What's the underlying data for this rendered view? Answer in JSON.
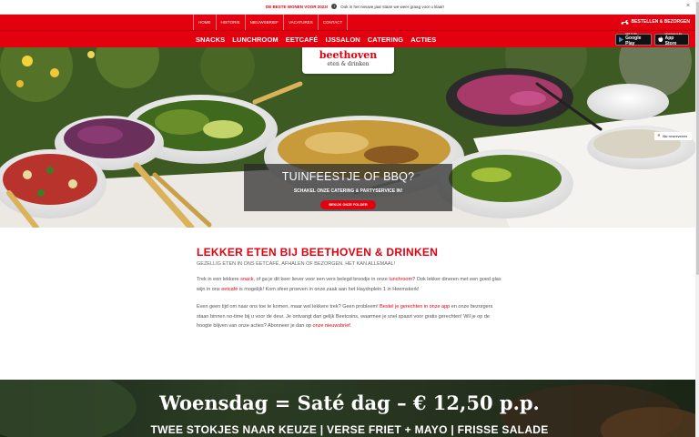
{
  "notice": {
    "headline": "DE BESTE WONEN VOOR 2023!",
    "message": "Ook in het nieuwe jaar staan we weer graag voor u klaar!",
    "close_label": "×"
  },
  "utilbar": {
    "links": [
      "Home",
      "Historie",
      "Nieuwsbrief",
      "Vacatures",
      "Contact"
    ],
    "order_label": "Bestellen & bezorgen"
  },
  "mainnav": {
    "items": [
      "Snacks",
      "Lunchroom",
      "Eetcafé",
      "IJssalon",
      "Catering",
      "Acties"
    ]
  },
  "apps": {
    "google": {
      "small": "GET IT ON",
      "big": "Google Play"
    },
    "apple": {
      "small": "Download on the",
      "big": "App Store"
    }
  },
  "logo": {
    "line1": "beethoven",
    "line2": "eten & drinken"
  },
  "hero": {
    "reserve_label": "Nu reserveren",
    "title": "Tuinfeestje of BBQ?",
    "subtitle": "Schakel onze catering & partyservice in!",
    "button": "Bekijk onze folder"
  },
  "content": {
    "heading": "Lekker eten bij Beethoven & Drinken",
    "subheading": "Gezellig eten in ons eetcafé, afhalen of bezorgen. Het kan allemaal!",
    "p1": {
      "a": "Trek in een lekkere ",
      "link1": "snack",
      "b": ", of ga je dit keer liever voor een vers belegd broodje in onze ",
      "link2": "lunchroom",
      "c": "? Ook lekker dineren met een goed glas wijn in ons ",
      "link3": "eetcafé",
      "d": " is mogelijk! Kom sfeer proeven in onze zaak aan het Haydnplein 1 in Heemskerk!"
    },
    "p2": {
      "a": "Even geen tijd om naar ons toe te komen, maar wel lekkere trek? Geen probleem! ",
      "link1": "Bestel je gerechten in onze app",
      "b": " en onze bezorgers staan binnen no-time bij u voor de deur. Je ontvangt dan gelijk Beetcoins, waarmee je snel spaart voor gratis gerechten! Wil je op de hoogte blijven van onze acties? Abonneer je dan op ",
      "link2": "onze nieuwsbrief",
      "c": "."
    }
  },
  "promo": {
    "title": "Woensdag = Saté dag – € 12,50 p.p.",
    "subtitle": "Twee stokjes naar keuze | verse friet + mayo | frisse salade"
  },
  "colors": {
    "brand": "#e3000f"
  }
}
